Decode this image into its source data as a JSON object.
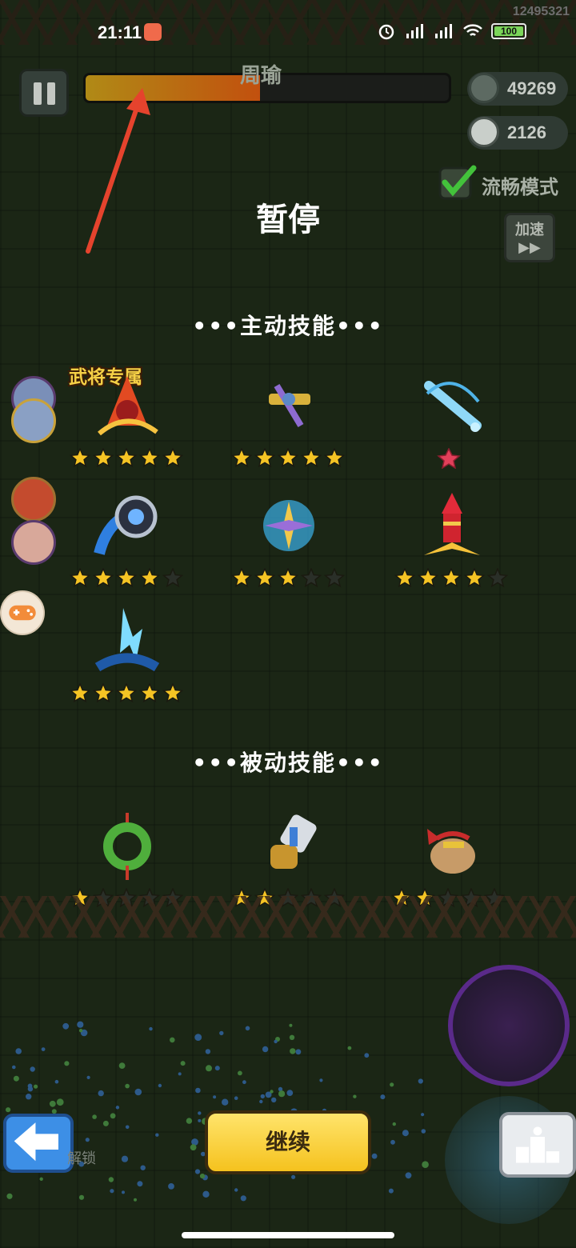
{
  "status_bar": {
    "time": "21:11",
    "device_id": "12495321",
    "battery": "100"
  },
  "hud": {
    "boss_name": "周瑜",
    "boss_hp_percent": 48,
    "coins": "49269",
    "kills": "2126",
    "smooth_mode_label": "流畅模式",
    "speed_label": "加速",
    "speed_icon": "fast-forward-icon"
  },
  "pause_title": "暂停",
  "active_skills": {
    "header": "•••主动技能•••",
    "exclusive_tag": "武将专属",
    "items": [
      {
        "icon": "fire-warrior-skill-icon",
        "stars": 5
      },
      {
        "icon": "golden-crossbow-skill-icon",
        "stars": 5
      },
      {
        "icon": "ice-sword-skill-icon",
        "stars": 0,
        "badge": "red-star-icon"
      },
      {
        "icon": "energy-orb-skill-icon",
        "stars": 4
      },
      {
        "icon": "shuriken-storm-skill-icon",
        "stars": 3
      },
      {
        "icon": "firework-rocket-skill-icon",
        "stars": 4
      },
      {
        "icon": "lightning-burst-skill-icon",
        "stars": 5
      }
    ]
  },
  "passive_skills": {
    "header": "•••被动技能•••",
    "items": [
      {
        "icon": "jade-pendant-icon",
        "stars": 1
      },
      {
        "icon": "gauntlet-icon",
        "stars": 2
      },
      {
        "icon": "lucky-bag-icon",
        "stars": 2
      }
    ]
  },
  "bottom": {
    "continue_label": "继续",
    "unlock_label": "解锁",
    "back_icon": "back-arrow-icon",
    "rank_icon": "podium-icon"
  },
  "colors": {
    "continue_yellow": "#f5c21e",
    "back_blue": "#3d8fe6",
    "star_gold": "#f5c424",
    "star_empty": "#2a2f28"
  }
}
